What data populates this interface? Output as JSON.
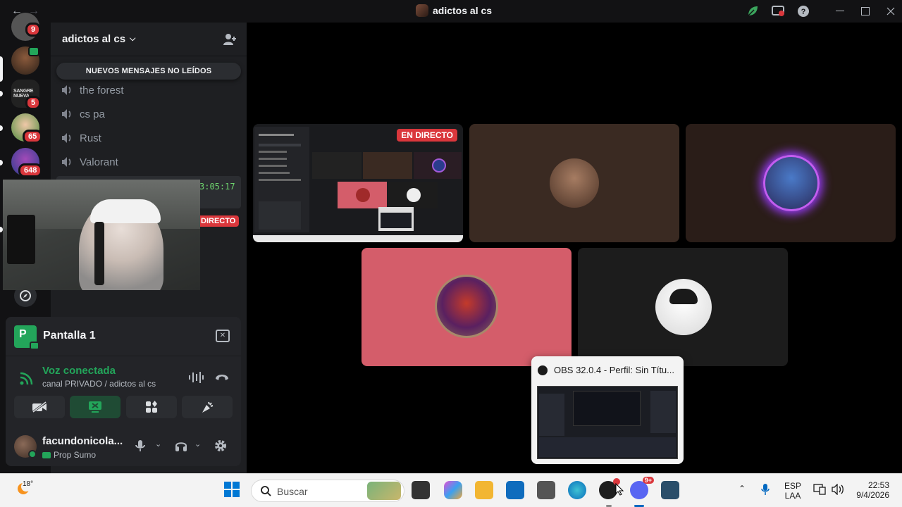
{
  "window": {
    "title": "adictos al cs"
  },
  "rail": {
    "badges": [
      "9",
      "5",
      "65",
      "648"
    ]
  },
  "channel_panel": {
    "guild_name": "adictos al cs",
    "new_messages_banner": "NUEVOS MENSAJES NO LEÍDOS",
    "channels": [
      {
        "name": "the forest"
      },
      {
        "name": "cs pa"
      },
      {
        "name": "Rust"
      },
      {
        "name": "Valorant"
      }
    ],
    "stream_timer": "3:05:17",
    "live_tag_partial": "DIRECTO"
  },
  "screen_panel": {
    "title": "Pantalla 1",
    "icon_letter": "P",
    "voice_status": "Voz conectada",
    "voice_channel": "canal PRIVADO / adictos al cs"
  },
  "user": {
    "name": "facundonicola...",
    "status_text": "Prop Sumo"
  },
  "stage": {
    "live_label": "EN DIRECTO"
  },
  "obs_popup": {
    "title": "OBS 32.0.4 - Perfil: Sin Títu..."
  },
  "taskbar": {
    "temperature": "18°",
    "search_placeholder": "Buscar",
    "notif_badge": "9+",
    "language_line1": "ESP",
    "language_line2": "LAA",
    "time": "22:53",
    "date": "9/4/2026"
  },
  "colors": {
    "accent_green": "#23a55a",
    "danger_red": "#da373c",
    "tile_pink": "#d45d6a",
    "tile_brown": "#3a2a22"
  }
}
